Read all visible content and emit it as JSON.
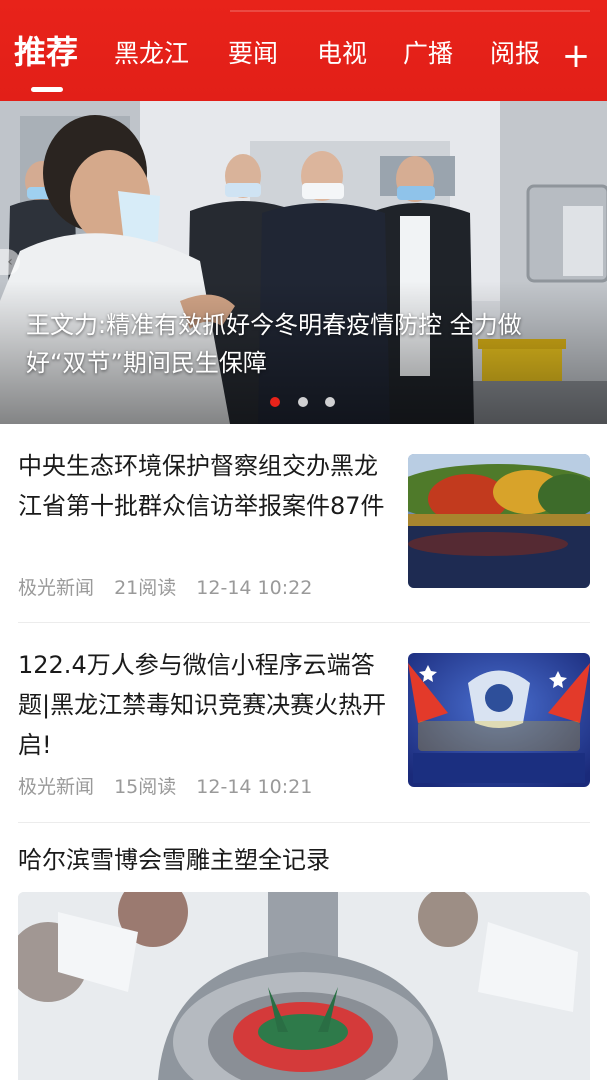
{
  "tabs": [
    {
      "label": "推荐"
    },
    {
      "label": "黑龙江"
    },
    {
      "label": "要闻"
    },
    {
      "label": "电视"
    },
    {
      "label": "广播"
    },
    {
      "label": "阅报"
    }
  ],
  "add_tab_label": "+",
  "carousel": {
    "caption": "王文力:精准有效抓好今冬明春疫情防控 全力做好“双节”期间民生保障",
    "active_index": 0,
    "total": 3
  },
  "news": [
    {
      "title": "中央生态环境保护督察组交办黑龙江省第十批群众信访举报案件87件",
      "source": "极光新闻",
      "reads": "21阅读",
      "time": "12-14 10:22"
    },
    {
      "title": "122.4万人参与微信小程序云端答题|黑龙江禁毒知识竞赛决赛火热开启!",
      "source": "极光新闻",
      "reads": "15阅读",
      "time": "12-14 10:21"
    }
  ],
  "feature": {
    "title": "哈尔滨雪博会雪雕主塑全记录"
  },
  "colors": {
    "brand_red": "#e8231a",
    "meta_gray": "#9a9a9a"
  }
}
